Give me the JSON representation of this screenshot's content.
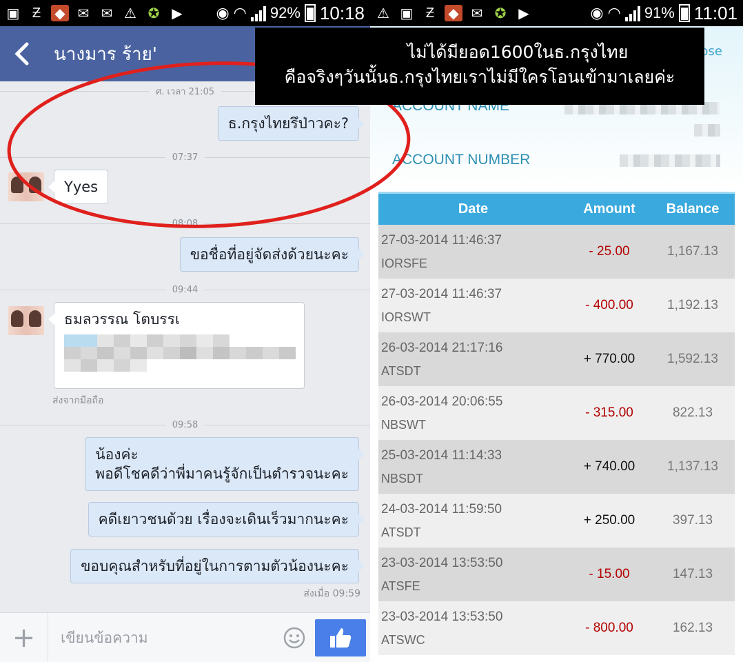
{
  "left": {
    "status": {
      "battery": "92%",
      "time": "10:18"
    },
    "header": {
      "contact_name": "นางมาร ร้าย'"
    },
    "dividers": [
      "ศ. เวลา 21:05",
      "07:37",
      "08:08",
      "09:44",
      "09:58"
    ],
    "messages": [
      {
        "text": "ธ.กรุงไทยรึป่าวคะ?"
      },
      {
        "text": "Yyes"
      },
      {
        "text": "ขอชื่อที่อยู่จัดส่งด้วยนะคะ"
      },
      {
        "text": "ธมลวรรณ โตบรรเ"
      },
      {
        "line1": "น้องค่ะ",
        "line2": "พอดีโชคดีว่าพี่มาคนรู้จักเป็นตำรวจนะคะ"
      },
      {
        "text": "คดีเยาวชนด้วย เรื่องจะเดินเร็วมากนะคะ"
      },
      {
        "text": "ขอบคุณสำหรับที่อยู่ในการตามตัวน้องนะคะ"
      }
    ],
    "sent_from_mobile": "ส่งจากมือถือ",
    "sent_at": "ส่งเมื่อ 09:59",
    "composer": {
      "placeholder": "เขียนข้อความ"
    },
    "icons": {
      "back": "chevron-left-icon",
      "plus": "plus-icon",
      "emoji": "smiley-icon",
      "like": "thumbs-up-icon"
    }
  },
  "right": {
    "status": {
      "battery": "91%",
      "time": "11:01"
    },
    "close_label": "ose",
    "account_name_label": "ACCOUNT NAME",
    "account_number_label": "ACCOUNT NUMBER",
    "table": {
      "headers": [
        "Date",
        "Amount",
        "Balance"
      ],
      "rows": [
        {
          "date": "27-03-2014 11:46:37",
          "code": "IORSFE",
          "amount": "- 25.00",
          "balance": "1,167.13",
          "sign": "neg"
        },
        {
          "date": "27-03-2014 11:46:37",
          "code": "IORSWT",
          "amount": "- 400.00",
          "balance": "1,192.13",
          "sign": "neg"
        },
        {
          "date": "26-03-2014 21:17:16",
          "code": "ATSDT",
          "amount": "+ 770.00",
          "balance": "1,592.13",
          "sign": "pos"
        },
        {
          "date": "26-03-2014 20:06:55",
          "code": "NBSWT",
          "amount": "- 315.00",
          "balance": "822.13",
          "sign": "neg"
        },
        {
          "date": "25-03-2014 11:14:33",
          "code": "NBSDT",
          "amount": "+ 740.00",
          "balance": "1,137.13",
          "sign": "pos"
        },
        {
          "date": "24-03-2014 11:59:50",
          "code": "ATSDT",
          "amount": "+ 250.00",
          "balance": "397.13",
          "sign": "pos"
        },
        {
          "date": "23-03-2014 13:53:50",
          "code": "ATSFE",
          "amount": "- 15.00",
          "balance": "147.13",
          "sign": "neg"
        },
        {
          "date": "23-03-2014 13:53:50",
          "code": "ATSWC",
          "amount": "- 800.00",
          "balance": "162.13",
          "sign": "neg"
        }
      ]
    }
  },
  "caption": {
    "line1": "ไม่ได้มียอด1600ในธ.กรุงไทย",
    "line2": "คือจริงๆวันนั้นธ.กรุงไทยเราไม่มีใครโอนเข้ามาเลยค่ะ"
  },
  "annotation_color": "#e0201c"
}
